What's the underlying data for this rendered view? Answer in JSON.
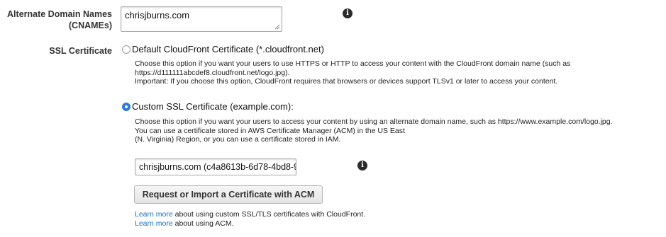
{
  "cnames": {
    "label_line1": "Alternate Domain Names",
    "label_line2": "(CNAMEs)",
    "value": "chrisjburns.com"
  },
  "ssl": {
    "label": "SSL Certificate",
    "default_option": {
      "label": "Default CloudFront Certificate (*.cloudfront.net)",
      "selected": false,
      "desc_lines": [
        "Choose this option if you want your users to use HTTPS or HTTP to access your content with the CloudFront domain name (such as",
        "https://d111111abcdef8.cloudfront.net/logo.jpg).",
        "Important: If you choose this option, CloudFront requires that browsers or devices support TLSv1 or later to access your content."
      ]
    },
    "custom_option": {
      "label": "Custom SSL Certificate (example.com):",
      "selected": true,
      "desc_lines": [
        "Choose this option if you want your users to access your content by using an alternate domain name, such as https://www.example.com/logo.jpg.",
        "You can use a certificate stored in AWS Certificate Manager (ACM) in the US East",
        "(N. Virginia) Region, or you can use a certificate stored in IAM."
      ],
      "certificate_value": "chrisjburns.com (c4a8613b-6d78-4bd8-9",
      "acm_button_label": "Request or Import a Certificate with ACM",
      "learn_more_1": {
        "link": "Learn more",
        "text": " about using custom SSL/TLS certificates with CloudFront."
      },
      "learn_more_2": {
        "link": "Learn more",
        "text": " about using ACM."
      }
    }
  },
  "icons": {
    "info": "info-icon"
  },
  "colors": {
    "link": "#1a6fc4",
    "radio_selected": "#2f7bd8"
  }
}
